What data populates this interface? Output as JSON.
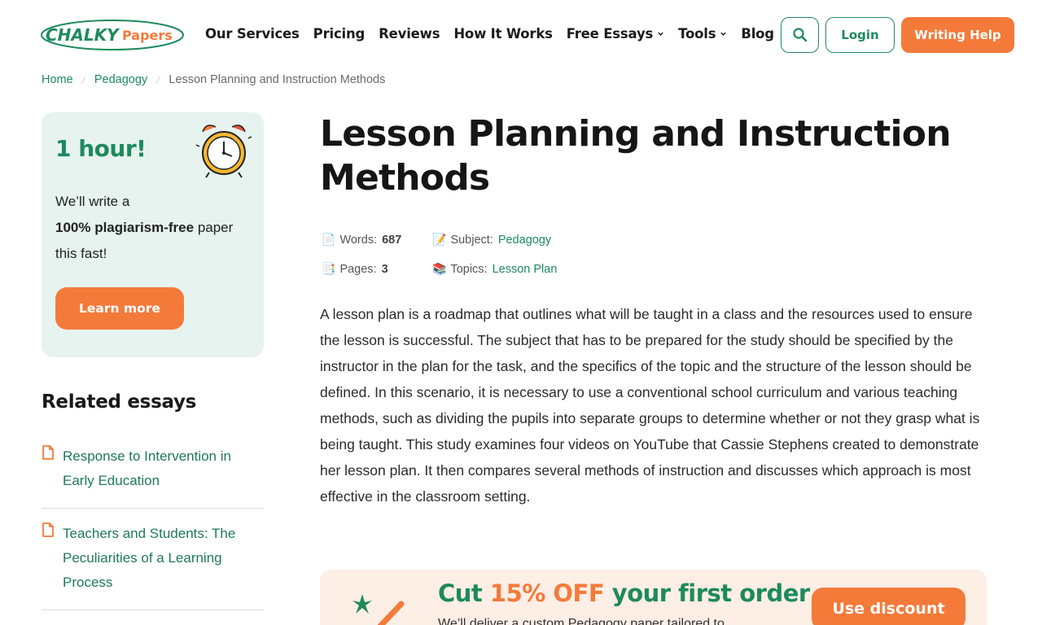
{
  "header": {
    "logo_left": "CHALKY",
    "logo_right": "Papers",
    "nav": [
      {
        "label": "Our Services",
        "dropdown": false
      },
      {
        "label": "Pricing",
        "dropdown": false
      },
      {
        "label": "Reviews",
        "dropdown": false
      },
      {
        "label": "How It Works",
        "dropdown": false
      },
      {
        "label": "Free Essays",
        "dropdown": true
      },
      {
        "label": "Tools",
        "dropdown": true
      },
      {
        "label": "Blog",
        "dropdown": false
      }
    ],
    "search_icon": "search-icon",
    "login_label": "Login",
    "help_label": "Writing Help"
  },
  "breadcrumb": {
    "home": "Home",
    "category": "Pedagogy",
    "current": "Lesson Planning and Instruction Methods"
  },
  "promo": {
    "title": "1 hour!",
    "line1": "We’ll write a",
    "bold": "100% plagiarism-free",
    "line2_rest": " paper",
    "line3": "this fast!",
    "button": "Learn more",
    "icon": "alarm-clock-icon"
  },
  "related": {
    "title": "Related essays",
    "items": [
      {
        "title": "Response to Intervention in Early Education"
      },
      {
        "title": "Teachers and Students: The Peculiarities of a Learning Process"
      }
    ]
  },
  "article": {
    "title": "Lesson Planning and Instruction Methods",
    "meta": {
      "words_label": "Words:",
      "words_value": "687",
      "subject_label": "Subject:",
      "subject_value": "Pedagogy",
      "pages_label": "Pages:",
      "pages_value": "3",
      "topics_label": "Topics:",
      "topics_value": "Lesson Plan"
    },
    "body": "A lesson plan is a roadmap that outlines what will be taught in a class and the resources used to ensure the lesson is successful. The subject that has to be prepared for the study should be specified by the instructor in the plan for the task, and the specifics of the topic and the structure of the lesson should be defined. In this scenario, it is necessary to use a conventional school curriculum and various teaching methods, such as dividing the pupils into separate groups to determine whether or not they grasp what is being taught. This study examines four videos on YouTube that Cassie Stephens created to demonstrate her lesson plan. It then compares several methods of instruction and discusses which approach is most effective in the classroom setting."
  },
  "discount": {
    "title_pre": "Cut ",
    "title_accent": "15% OFF",
    "title_post": " your first order",
    "subtitle": "We’ll deliver a custom Pedagogy paper tailored to",
    "button": "Use discount"
  },
  "colors": {
    "brand_green": "#1e8a5c",
    "brand_orange": "#f47a3a",
    "promo_bg": "#e6f3ee",
    "discount_bg": "#fdeee6"
  }
}
